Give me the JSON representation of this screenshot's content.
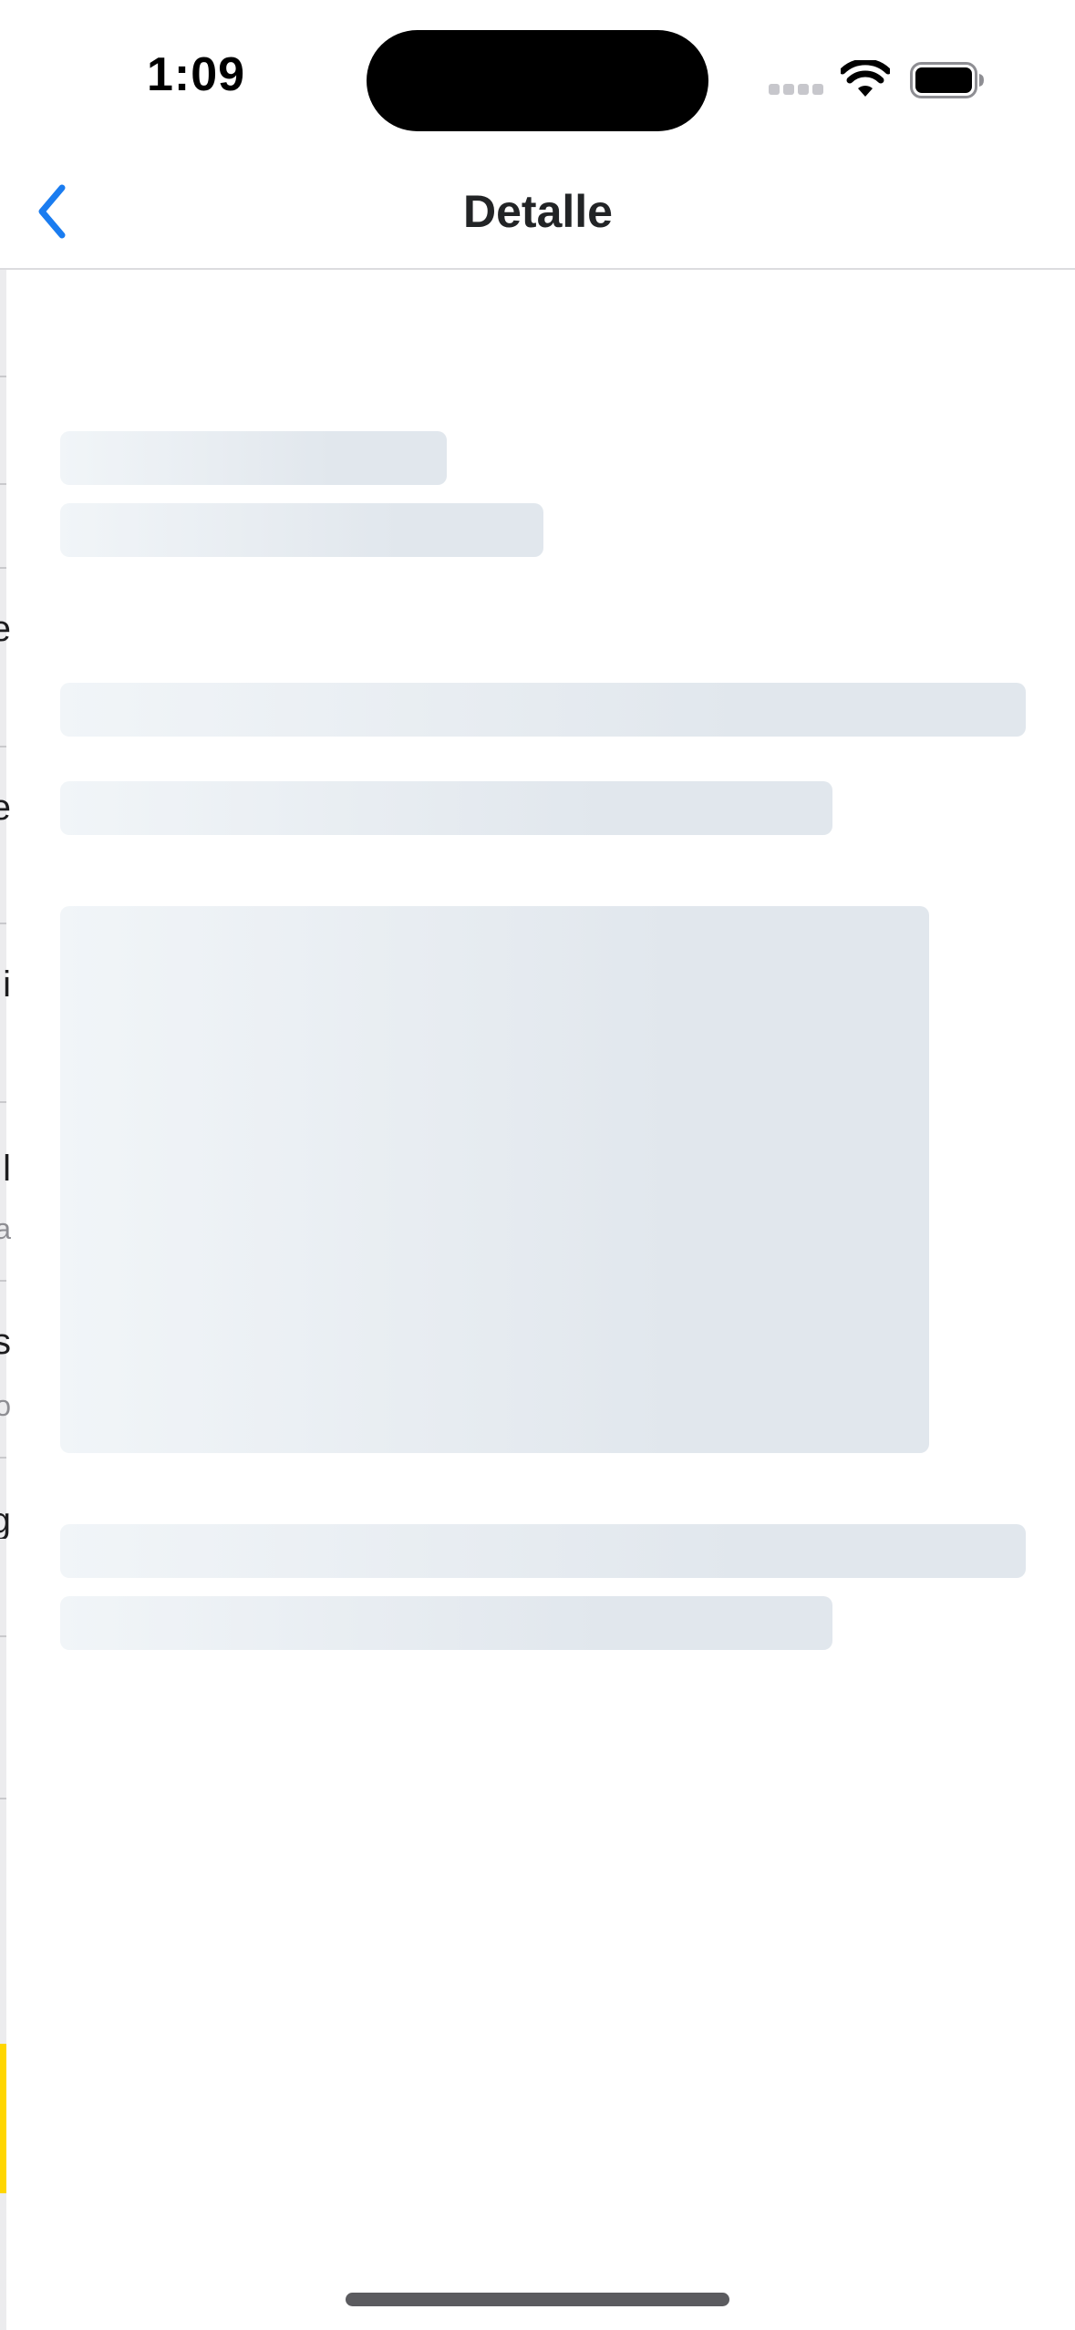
{
  "status_bar": {
    "time": "1:09",
    "icons": [
      "cellular-signal-icon",
      "wifi-icon",
      "battery-icon"
    ]
  },
  "nav": {
    "title": "Detalle",
    "back_icon": "chevron-left-icon",
    "accent_color": "#1a7cf0"
  },
  "background_screen": {
    "partial_glyphs": [
      "e",
      "e",
      "i",
      "l",
      "a",
      "s",
      "o",
      "g"
    ]
  },
  "content": {
    "state": "loading",
    "skeleton_color": "#e1e7ed"
  }
}
